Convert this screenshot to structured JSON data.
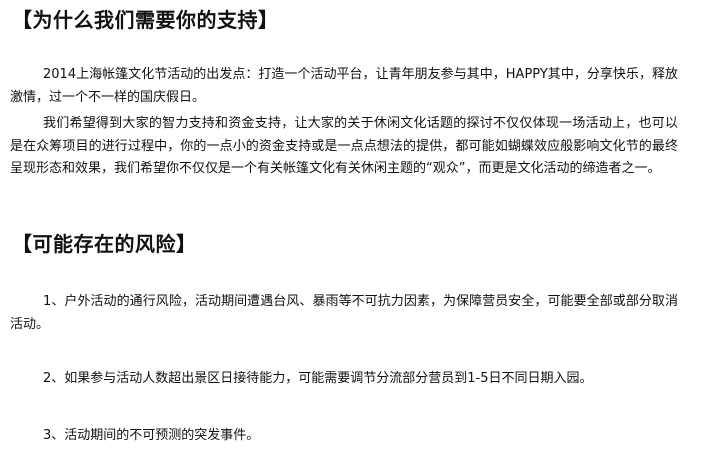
{
  "sections": [
    {
      "heading": "【为什么我们需要你的支持】",
      "paragraphs": [
        "2014上海帐篷文化节活动的出发点：打造一个活动平台，让青年朋友参与其中，HAPPY其中，分享快乐，释放激情，过一个不一样的国庆假日。",
        "我们希望得到大家的智力支持和资金支持，让大家的关于休闲文化话题的探讨不仅仅体现一场活动上，也可以是在众筹项目的进行过程中，你的一点小的资金支持或是一点点想法的提供，都可能如蝴蝶效应般影响文化节的最终呈现形态和效果，我们希望你不仅仅是一个有关帐篷文化有关休闲主题的“观众”，而更是文化活动的缔造者之一。"
      ]
    },
    {
      "heading": "【可能存在的风险】",
      "paragraphs": [
        "1、户外活动的通行风险，活动期间遭遇台风、暴雨等不可抗力因素，为保障营员安全，可能要全部或部分取消活动。",
        "2、如果参与活动人数超出景区日接待能力，可能需要调节分流部分营员到1-5日不同日期入园。",
        "3、活动期间的不可预测的突发事件。"
      ]
    }
  ]
}
